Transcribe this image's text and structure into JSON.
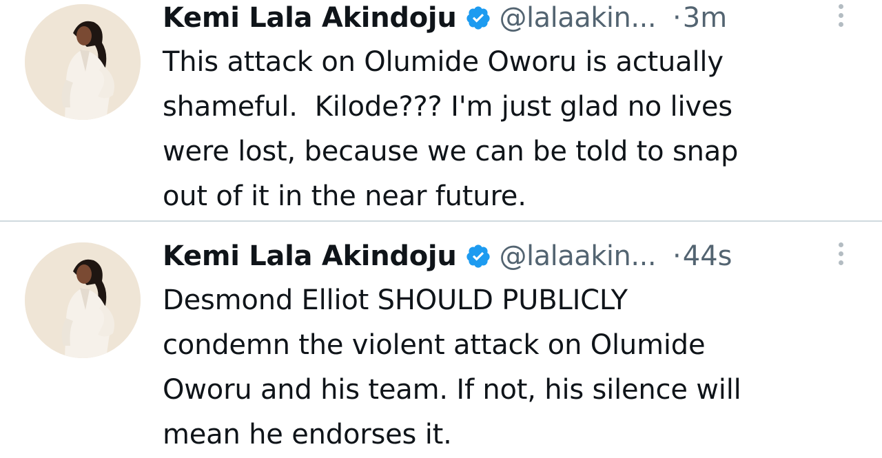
{
  "tweets": [
    {
      "author_name": "Kemi Lala Akindoju",
      "verified": true,
      "handle": "@lalaakin...",
      "separator": "·",
      "time": "3m",
      "text_lines": [
        "This attack on Olumide Oworu is actually",
        "shameful.  Kilode??? I'm just glad no lives",
        "were lost, because we can be told to snap",
        "out of it in the near future."
      ],
      "more_icon": "more-vertical-icon"
    },
    {
      "author_name": "Kemi Lala Akindoju",
      "verified": true,
      "handle": "@lalaakin...",
      "separator": "·",
      "time": "44s",
      "text_lines": [
        "Desmond Elliot SHOULD PUBLICLY",
        "condemn the violent attack on Olumide",
        "Oworu and his team. If not, his silence will",
        "mean he endorses it."
      ],
      "more_icon": "more-vertical-icon"
    }
  ],
  "colors": {
    "verified_badge": "#1d9bf0",
    "secondary_text": "#536471",
    "primary_text": "#0f1419",
    "divider": "#cfd9de"
  }
}
